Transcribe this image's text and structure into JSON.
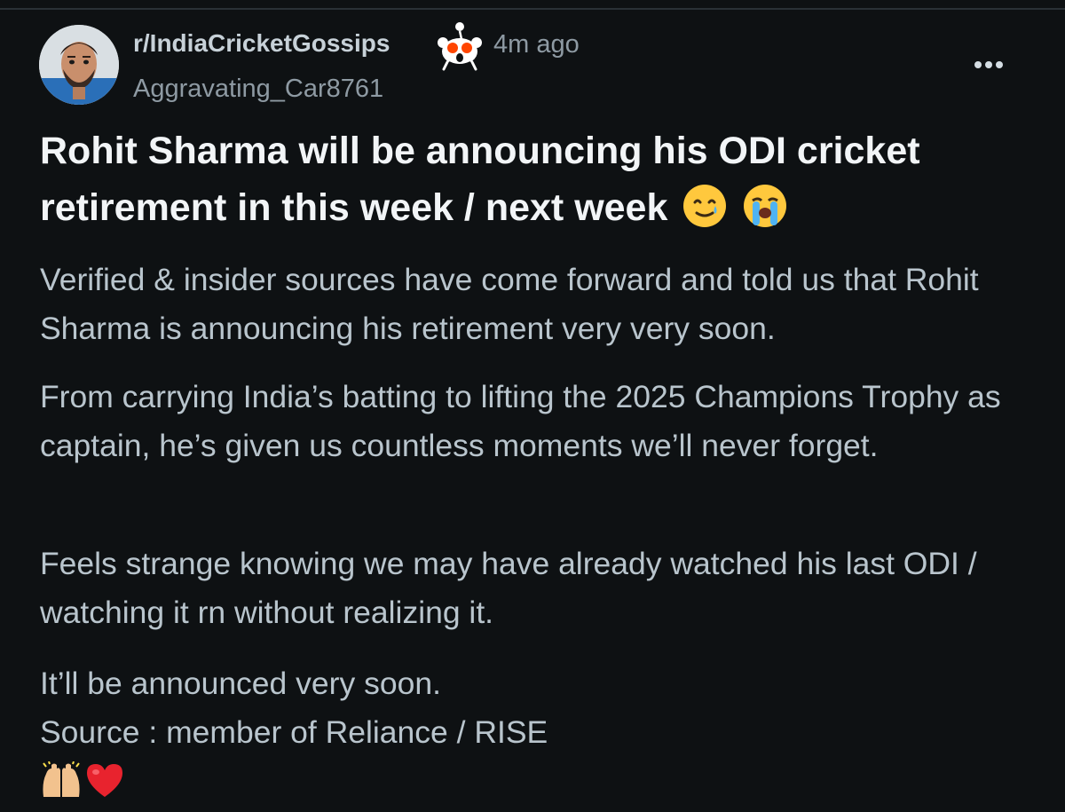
{
  "post": {
    "subreddit": "r/IndiaCricketGossips",
    "time_ago": "4m ago",
    "author": "Aggravating_Car8761",
    "title": "Rohit Sharma will be announcing his ODI cricket retirement in this week / next week",
    "title_emojis": [
      "smiling-face-with-tear",
      "loudly-crying-face"
    ],
    "paragraphs": [
      "Verified & insider sources have come forward and told us that Rohit Sharma is announcing his retirement very very soon.",
      "From carrying India’s batting to lifting the 2025 Champions Trophy as captain, he’s given us countless moments we’ll never forget.",
      "Feels strange knowing we may have already watched his last ODI / watching it rn without realizing it."
    ],
    "closing_line": "It’ll be announced very soon.",
    "source_line": "Source : member of Reliance / RISE",
    "footer_emojis": [
      "raising-hands",
      "red-heart"
    ]
  },
  "icons": {
    "avatar": "user-avatar",
    "subreddit_badge": "snoo-shocked-icon",
    "more": "more-dots-icon"
  },
  "colors": {
    "background": "#0e1113",
    "title": "#f2f5f7",
    "body": "#b9c5cd",
    "muted": "#8e9aa3"
  }
}
